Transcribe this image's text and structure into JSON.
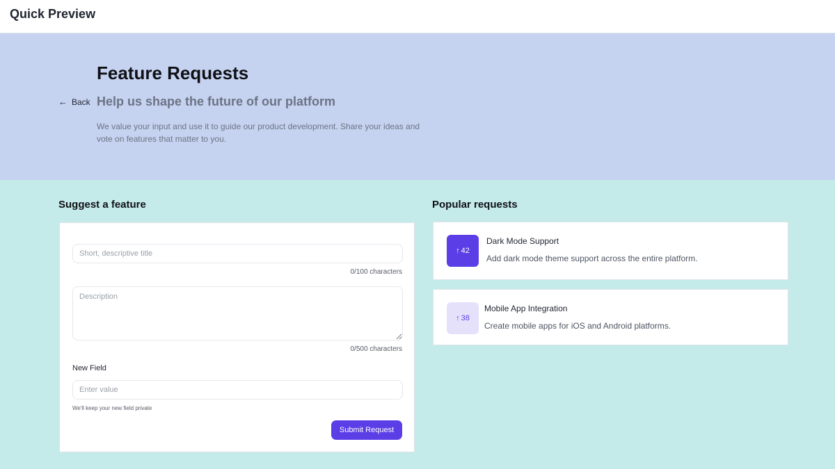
{
  "app": {
    "title": "Quick Preview"
  },
  "hero": {
    "back_label": "Back",
    "title": "Feature Requests",
    "subtitle": "Help us shape the future of our platform",
    "description": "We value your input and use it to guide our product development. Share your ideas and vote on features that matter to you."
  },
  "suggest": {
    "heading": "Suggest a feature",
    "title_placeholder": "Short, descriptive title",
    "title_value": "",
    "title_counter": "0/100 characters",
    "description_placeholder": "Description",
    "description_value": "",
    "description_counter": "0/500 characters",
    "new_field_label": "New Field",
    "new_field_placeholder": "Enter value",
    "new_field_value": "",
    "new_field_hint": "We'll keep your new field private",
    "submit_label": "Submit Request"
  },
  "popular": {
    "heading": "Popular requests",
    "items": [
      {
        "votes": "42",
        "title": "Dark Mode Support",
        "description": "Add dark mode theme support across the entire platform.",
        "voted": true
      },
      {
        "votes": "38",
        "title": "Mobile App Integration",
        "description": "Create mobile apps for iOS and Android platforms.",
        "voted": false
      }
    ]
  },
  "colors": {
    "accent": "#5b3ee6",
    "hero_bg": "#c6d3f0",
    "page_bg": "#c4eaea",
    "vote_inactive_bg": "#e6e1fb"
  },
  "icons": {
    "back": "arrow-left-icon",
    "upvote": "arrow-up-icon"
  }
}
